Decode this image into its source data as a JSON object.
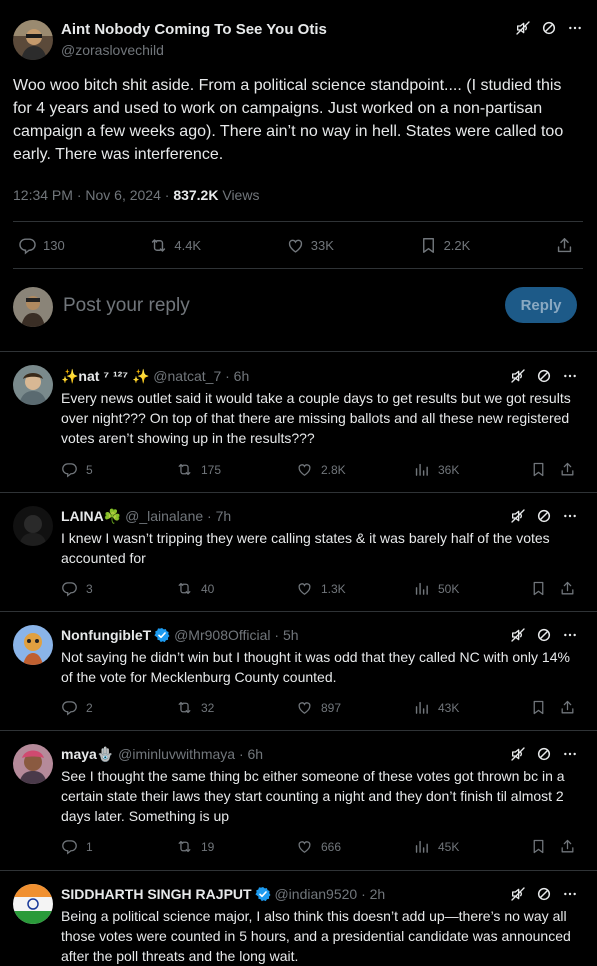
{
  "main_tweet": {
    "author_name": "Aint Nobody Coming To See You Otis",
    "author_handle": "@zoraslovechild",
    "text": "Woo woo bitch shit aside. From a political science standpoint.... (I studied this for 4 years and used to work on campaigns. Just worked on a non-partisan campaign a few weeks ago). There ain’t no way in hell. States were called too early. There was interference.",
    "time": "12:34 PM · Nov 6, 2024 · ",
    "views_count": "837.2K",
    "views_label": " Views",
    "stats": {
      "replies": "130",
      "reposts": "4.4K",
      "likes": "33K",
      "bookmarks": "2.2K"
    }
  },
  "reply_box": {
    "placeholder": "Post your reply",
    "button_label": "Reply"
  },
  "replies": [
    {
      "name": "✨nat ⁷ ¹²⁷ ✨",
      "handle": " @natcat_7 · 6h",
      "text": "Every news outlet said it would take a couple days to get results but we got results over night??? On top of that there are missing ballots and all these new registered votes aren’t showing up in the results???",
      "replies": "5",
      "reposts": "175",
      "likes": "2.8K",
      "views": "36K"
    },
    {
      "name": "LAINA☘️",
      "handle": " @_lainalane · 7h",
      "text": "I knew I wasn’t tripping they were calling states & it was barely half of the votes accounted for",
      "replies": "3",
      "reposts": "40",
      "likes": "1.3K",
      "views": "50K"
    },
    {
      "name": "NonfungibleT",
      "handle": " @Mr908Official · 5h",
      "text": "Not saying he didn’t win but I thought it was odd that they called NC with only 14% of the vote for Mecklenburg County counted.",
      "replies": "2",
      "reposts": "32",
      "likes": "897",
      "views": "43K"
    },
    {
      "name": "maya🪬",
      "handle": " @iminluvwithmaya · 6h",
      "text": "See I thought the same thing bc either someone of these votes got thrown bc in a certain state their laws they start counting a night and they don’t finish til almost 2 days later. Something is up",
      "replies": "1",
      "reposts": "19",
      "likes": "666",
      "views": "45K"
    },
    {
      "name": "SIDDHARTH SINGH RAJPUT",
      "handle": " @indian9520 · 2h",
      "text": "Being a political science major, I also think this doesn’t add up—there’s no way all those votes were counted in 5 hours, and a presidential candidate was announced after the poll threats and the long wait."
    }
  ],
  "colors": {
    "background": "#000000",
    "text": "#e7e9ea",
    "muted": "#71767b",
    "divider": "#2f3336",
    "verified": "#1d9bf0",
    "reply_button": "#1d5a88"
  },
  "icons": [
    "mute-icon",
    "block-icon",
    "more-icon",
    "reply-icon",
    "repost-icon",
    "like-icon",
    "views-icon",
    "bookmark-icon",
    "share-icon",
    "verified-icon"
  ]
}
